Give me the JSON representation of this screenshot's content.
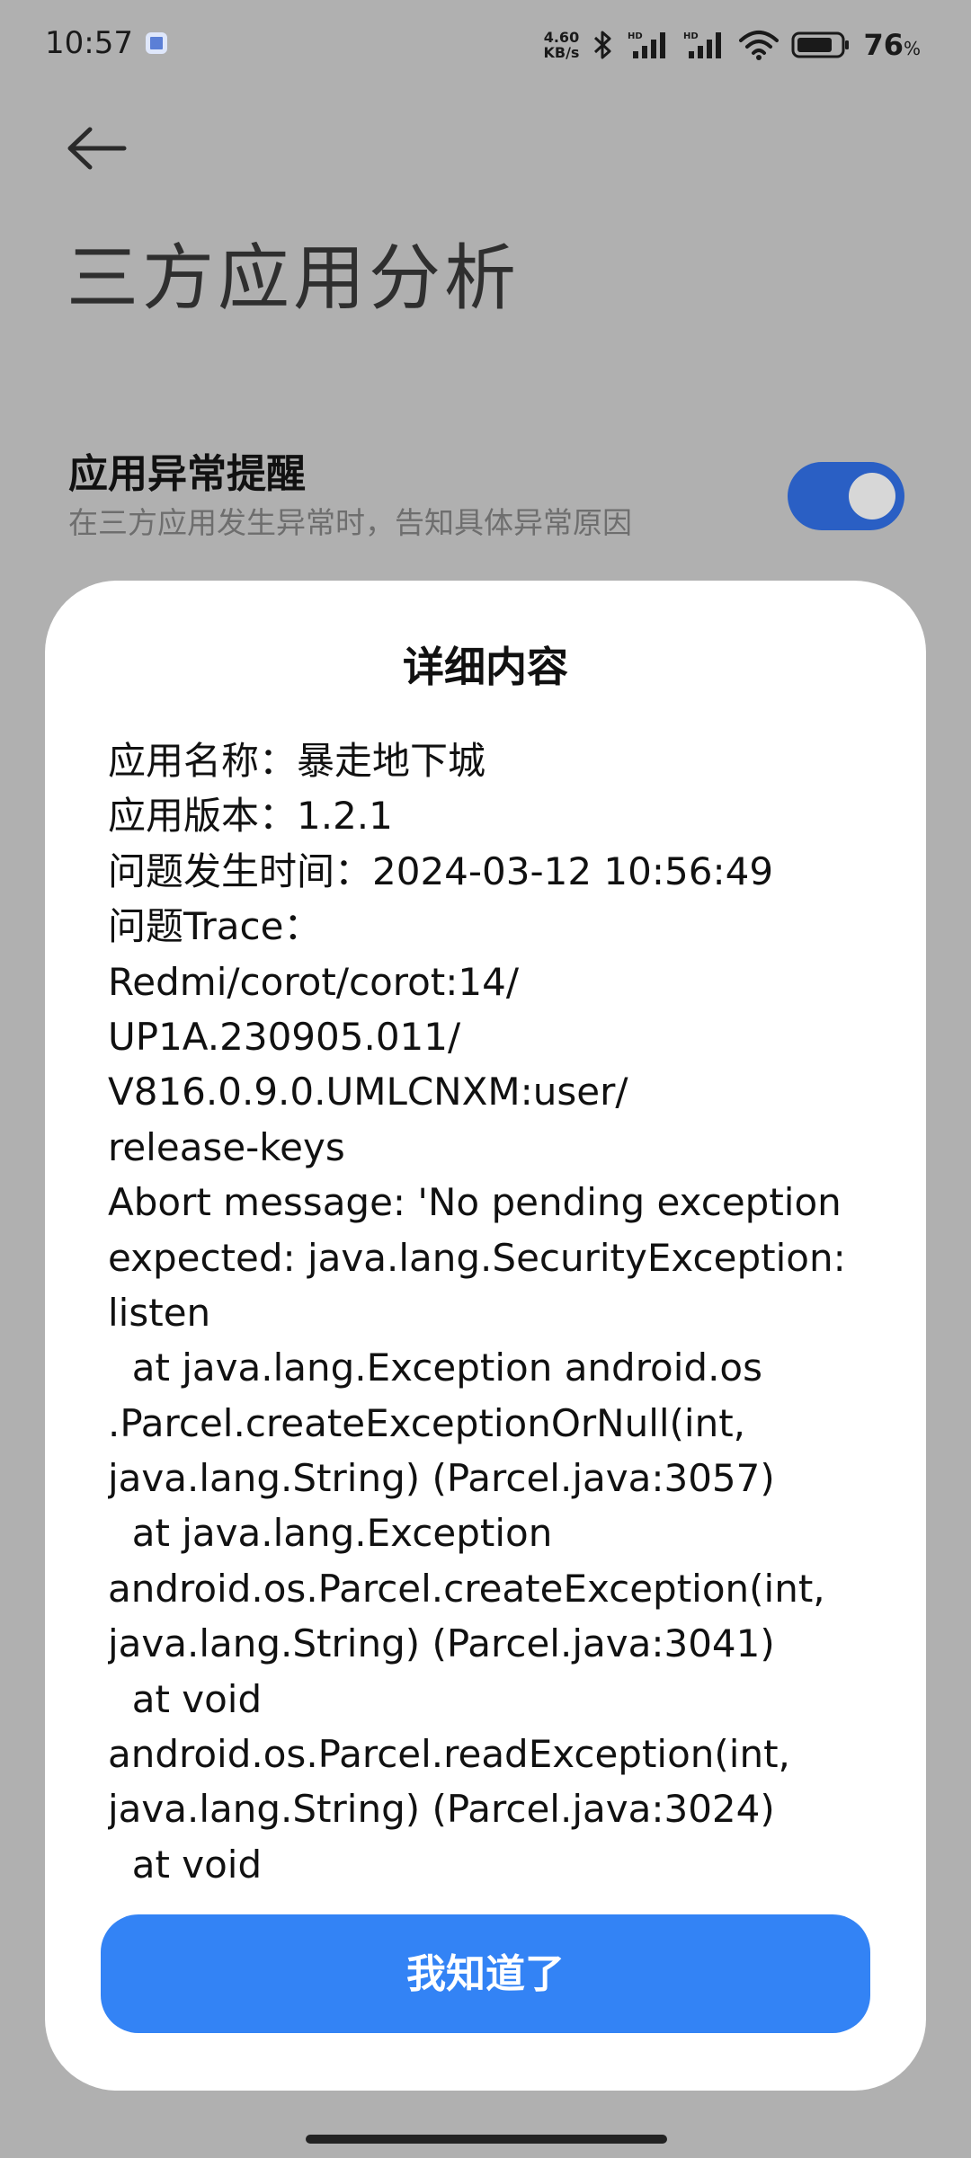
{
  "status_bar": {
    "time": "10:57",
    "net_speed_value": "4.60",
    "net_speed_unit": "KB/s",
    "battery_percent": "76",
    "battery_unit": "%",
    "icons": [
      "bluetooth-icon",
      "hd-signal-icon",
      "hd-signal-icon",
      "wifi-icon",
      "battery-icon"
    ]
  },
  "header": {
    "title": "三方应用分析"
  },
  "setting": {
    "title": "应用异常提醒",
    "subtitle": "在三方应用发生异常时，告知具体异常原因",
    "enabled": true
  },
  "dialog": {
    "title": "详细内容",
    "lines": [
      "应用名称：暴走地下城",
      "应用版本：1.2.1",
      "问题发生时间：2024-03-12 10:56:49",
      "问题Trace：",
      "Redmi/corot/corot:14/",
      "UP1A.230905.011/",
      "V816.0.9.0.UMLCNXM:user/",
      "release-keys",
      "Abort message: 'No pending exception",
      "expected: java.lang.SecurityException:",
      "listen",
      "  at java.lang.Exception android.os",
      ".Parcel.createExceptionOrNull(int,",
      "java.lang.String) (Parcel.java:3057)",
      "  at java.lang.Exception",
      "android.os.Parcel.createException(int,",
      "java.lang.String) (Parcel.java:3041)",
      "  at void",
      "android.os.Parcel.readException(int,",
      "java.lang.String) (Parcel.java:3024)",
      "  at void"
    ],
    "confirm_label": "我知道了"
  },
  "colors": {
    "accent": "#3383f5",
    "toggle_on": "#2a5fc4",
    "scrim": "#b0b0b0"
  }
}
